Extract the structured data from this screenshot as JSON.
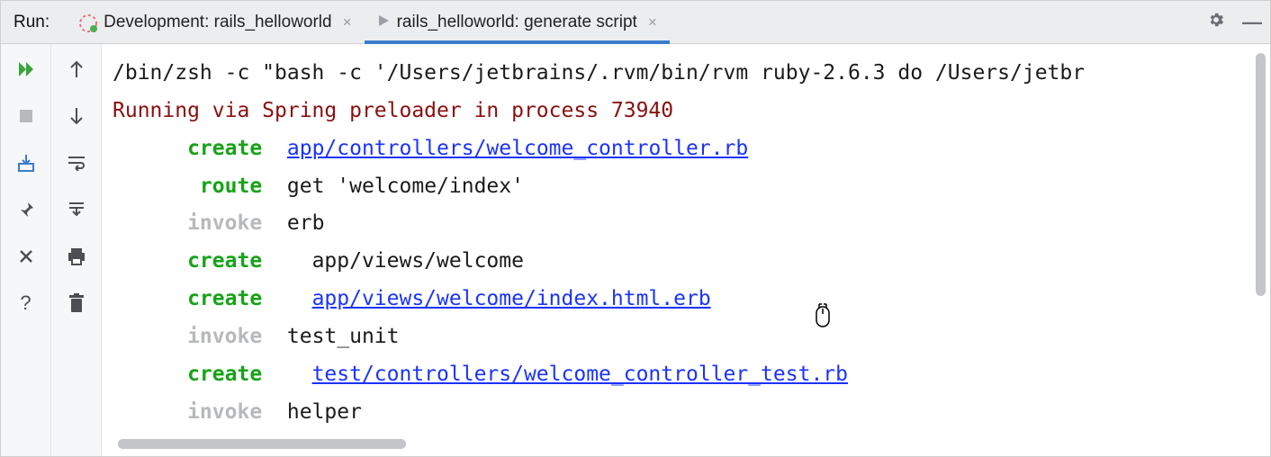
{
  "header": {
    "label": "Run:",
    "tabs": [
      {
        "label": "Development: rails_helloworld",
        "active": false,
        "icon": "rails"
      },
      {
        "label": "rails_helloworld: generate script",
        "active": true,
        "icon": "play"
      }
    ]
  },
  "console": {
    "command": "/bin/zsh -c \"bash -c '/Users/jetbrains/.rvm/bin/rvm ruby-2.6.3 do /Users/jetbr",
    "spring": "Running via Spring preloader in process 73940",
    "lines": [
      {
        "keyword": "create",
        "keywordClass": "kw-green",
        "text": "app/controllers/welcome_controller.rb",
        "link": true,
        "indent": "  "
      },
      {
        "keyword": "route",
        "keywordClass": "kw-green",
        "text": "get 'welcome/index'",
        "link": false,
        "indent": "  "
      },
      {
        "keyword": "invoke",
        "keywordClass": "kw-grey",
        "text": "erb",
        "link": false,
        "indent": "  "
      },
      {
        "keyword": "create",
        "keywordClass": "kw-green",
        "text": "app/views/welcome",
        "link": false,
        "indent": "    "
      },
      {
        "keyword": "create",
        "keywordClass": "kw-green",
        "text": "app/views/welcome/index.html.erb",
        "link": true,
        "indent": "    "
      },
      {
        "keyword": "invoke",
        "keywordClass": "kw-grey",
        "text": "test_unit",
        "link": false,
        "indent": "  "
      },
      {
        "keyword": "create",
        "keywordClass": "kw-green",
        "text": "test/controllers/welcome_controller_test.rb",
        "link": true,
        "indent": "    "
      },
      {
        "keyword": "invoke",
        "keywordClass": "kw-grey",
        "text": "helper",
        "link": false,
        "indent": "  "
      }
    ]
  }
}
